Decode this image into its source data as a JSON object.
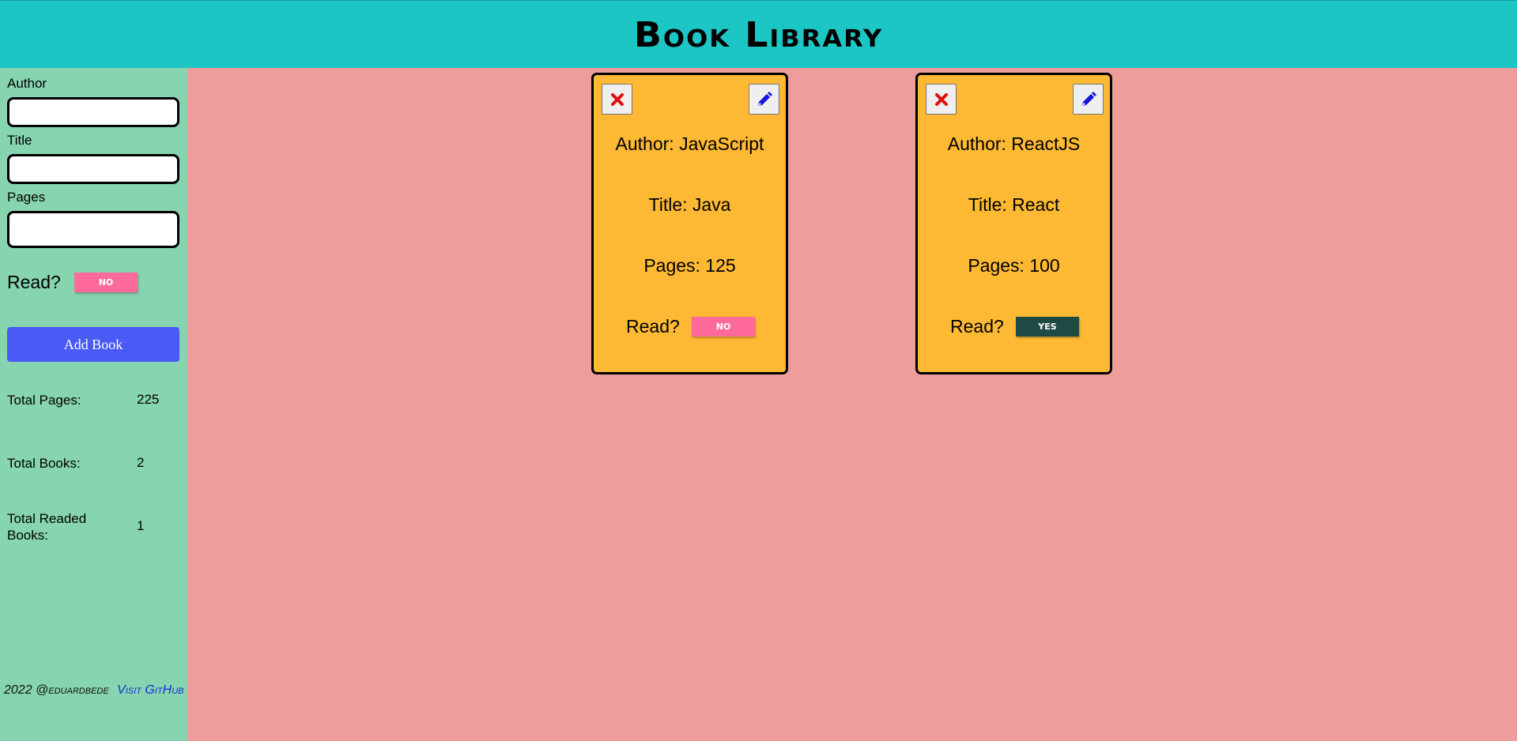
{
  "header": {
    "title": "Book Library"
  },
  "form": {
    "author_label": "Author",
    "author_value": "",
    "title_label": "Title",
    "title_value": "",
    "pages_label": "Pages",
    "pages_value": "",
    "read_label": "Read?",
    "read_toggle": "NO",
    "add_button": "Add Book"
  },
  "stats": {
    "total_pages_label": "Total Pages:",
    "total_pages_value": "225",
    "total_books_label": "Total Books:",
    "total_books_value": "2",
    "total_read_label": "Total Readed Books:",
    "total_read_value": "1"
  },
  "footer": {
    "copyright": "2022 @eduardbede",
    "github_link": "Visit GitHub"
  },
  "books": [
    {
      "author": "Author: JavaScript",
      "title": "Title: Java",
      "pages": "Pages: 125",
      "read_label": "Read?",
      "read_status": "NO"
    },
    {
      "author": "Author: ReactJS",
      "title": "Title: React",
      "pages": "Pages: 100",
      "read_label": "Read?",
      "read_status": "YES"
    }
  ],
  "icons": {
    "delete": "close-icon",
    "edit": "pencil-icon"
  },
  "colors": {
    "header_bg": "#1cc6c5",
    "sidebar_bg": "#86d4b0",
    "main_bg": "#ef9c9d",
    "card_bg": "#fdb933",
    "button_bg": "#4a5af4",
    "toggle_no": "#fe6b9a",
    "toggle_yes": "#1d4b43"
  }
}
